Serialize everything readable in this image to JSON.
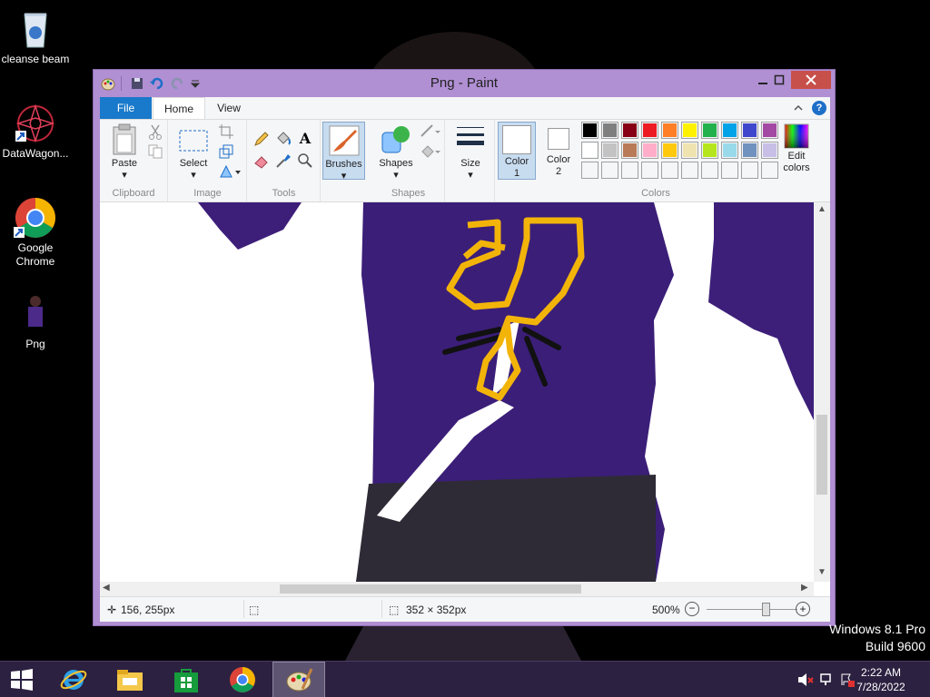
{
  "desktop": {
    "icons": [
      {
        "label": "cleanse beam",
        "icon": "recycle-bin-icon"
      },
      {
        "label": "DataWagon...",
        "icon": "datawagon-icon"
      },
      {
        "label": "Google Chrome",
        "icon": "chrome-icon"
      },
      {
        "label": "Png",
        "icon": "image-file-icon"
      }
    ],
    "os_edition": "Windows 8.1 Pro",
    "os_build": "Build 9600"
  },
  "window": {
    "title": "Png - Paint",
    "tabs": {
      "file": "File",
      "home": "Home",
      "view": "View"
    },
    "ribbon": {
      "clipboard": {
        "label": "Clipboard",
        "paste": "Paste"
      },
      "image": {
        "label": "Image",
        "select": "Select"
      },
      "tools": {
        "label": "Tools"
      },
      "brushes": {
        "label": "Brushes"
      },
      "shapes": {
        "label": "Shapes",
        "button": "Shapes"
      },
      "size": {
        "label": "Size"
      },
      "colors": {
        "label": "Colors",
        "color1_line1": "Color",
        "color1_line2": "1",
        "color2_line1": "Color",
        "color2_line2": "2",
        "edit_line1": "Edit",
        "edit_line2": "colors",
        "color1_value": "#ffffff",
        "color2_value": "#ffffff",
        "palette_row1": [
          "#000000",
          "#7f7f7f",
          "#880015",
          "#ed1c24",
          "#ff7f27",
          "#fff200",
          "#22b14c",
          "#00a2e8",
          "#3f48cc",
          "#a349a4"
        ],
        "palette_row2": [
          "#ffffff",
          "#c3c3c3",
          "#b97a57",
          "#ffaec9",
          "#ffc90e",
          "#efe4b0",
          "#b5e61d",
          "#99d9ea",
          "#7092be",
          "#c8bfe7"
        ],
        "palette_row3": [
          "#f5f6f7",
          "#f5f6f7",
          "#f5f6f7",
          "#f5f6f7",
          "#f5f6f7",
          "#f5f6f7",
          "#f5f6f7",
          "#f5f6f7",
          "#f5f6f7",
          "#f5f6f7"
        ]
      }
    },
    "status": {
      "cursor_pos": "156, 255px",
      "selection_size": "",
      "image_size": "352 × 352px",
      "zoom": "500%"
    }
  },
  "taskbar": {
    "time": "2:22 AM",
    "date": "7/28/2022",
    "apps": [
      "internet-explorer-icon",
      "file-explorer-icon",
      "store-icon",
      "chrome-icon",
      "paint-icon"
    ]
  }
}
